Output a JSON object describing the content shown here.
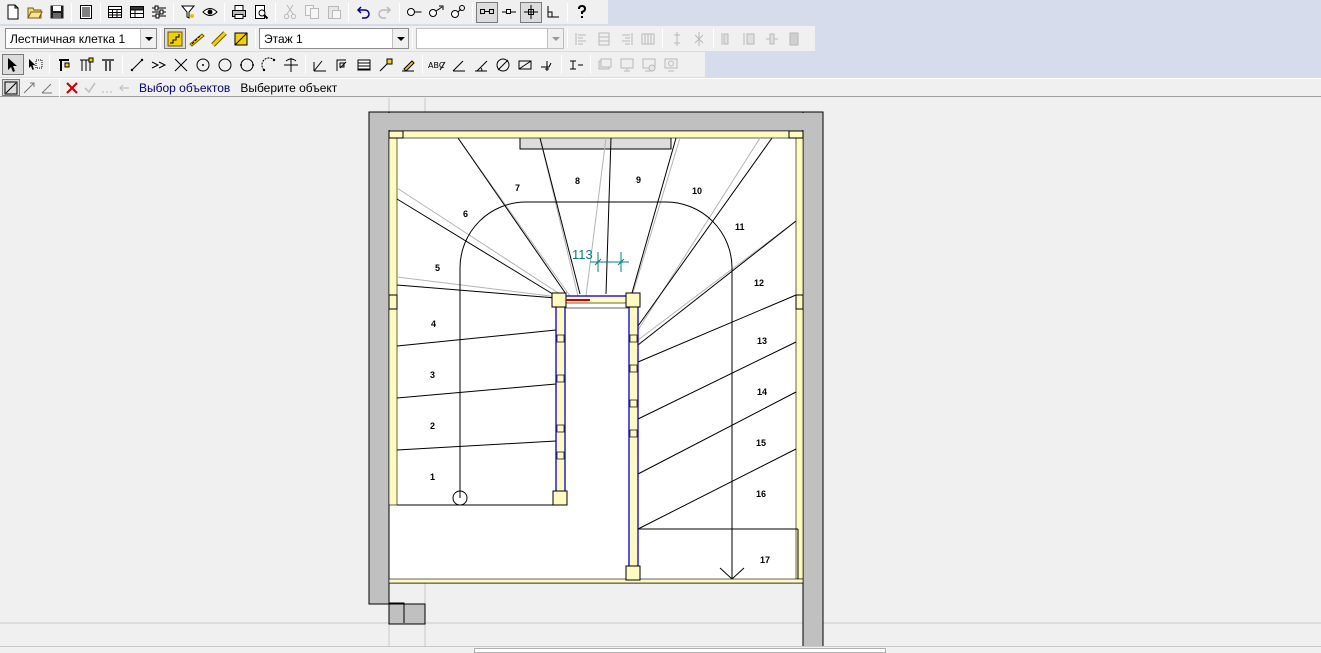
{
  "toolbar": {
    "row1": [
      "new-file-icon",
      "open-folder-icon",
      "save-icon",
      "properties-icon",
      "table-icon",
      "table-grid-icon",
      "settings-sliders-icon",
      "filter-icon",
      "view-icon",
      "print-icon",
      "print-preview-icon",
      "cut-icon",
      "copy-icon",
      "paste-icon",
      "undo-icon",
      "redo-icon",
      "node-icon",
      "node-add-icon",
      "node-settings-icon",
      "snap-ortho-icon",
      "snap-point-icon",
      "crosshair-icon",
      "angle-icon",
      "help-icon"
    ],
    "object_type": "Лестничная клетка 1",
    "floor": "Этаж 1",
    "empty_combo": ""
  },
  "command_line": {
    "prompt": "Выбор объектов",
    "hint": "Выберите объект"
  },
  "drawing": {
    "step_numbers": [
      "1",
      "2",
      "3",
      "4",
      "5",
      "6",
      "7",
      "8",
      "9",
      "10",
      "11",
      "12",
      "13",
      "14",
      "15",
      "16",
      "17"
    ],
    "dimension": "113",
    "colors": {
      "wall": "#c0c0c0",
      "floor": "#ffffff",
      "post": "#fffac0",
      "stringer": "#0000cc",
      "dimension": "#008080",
      "arrow": "#cc0000"
    }
  }
}
